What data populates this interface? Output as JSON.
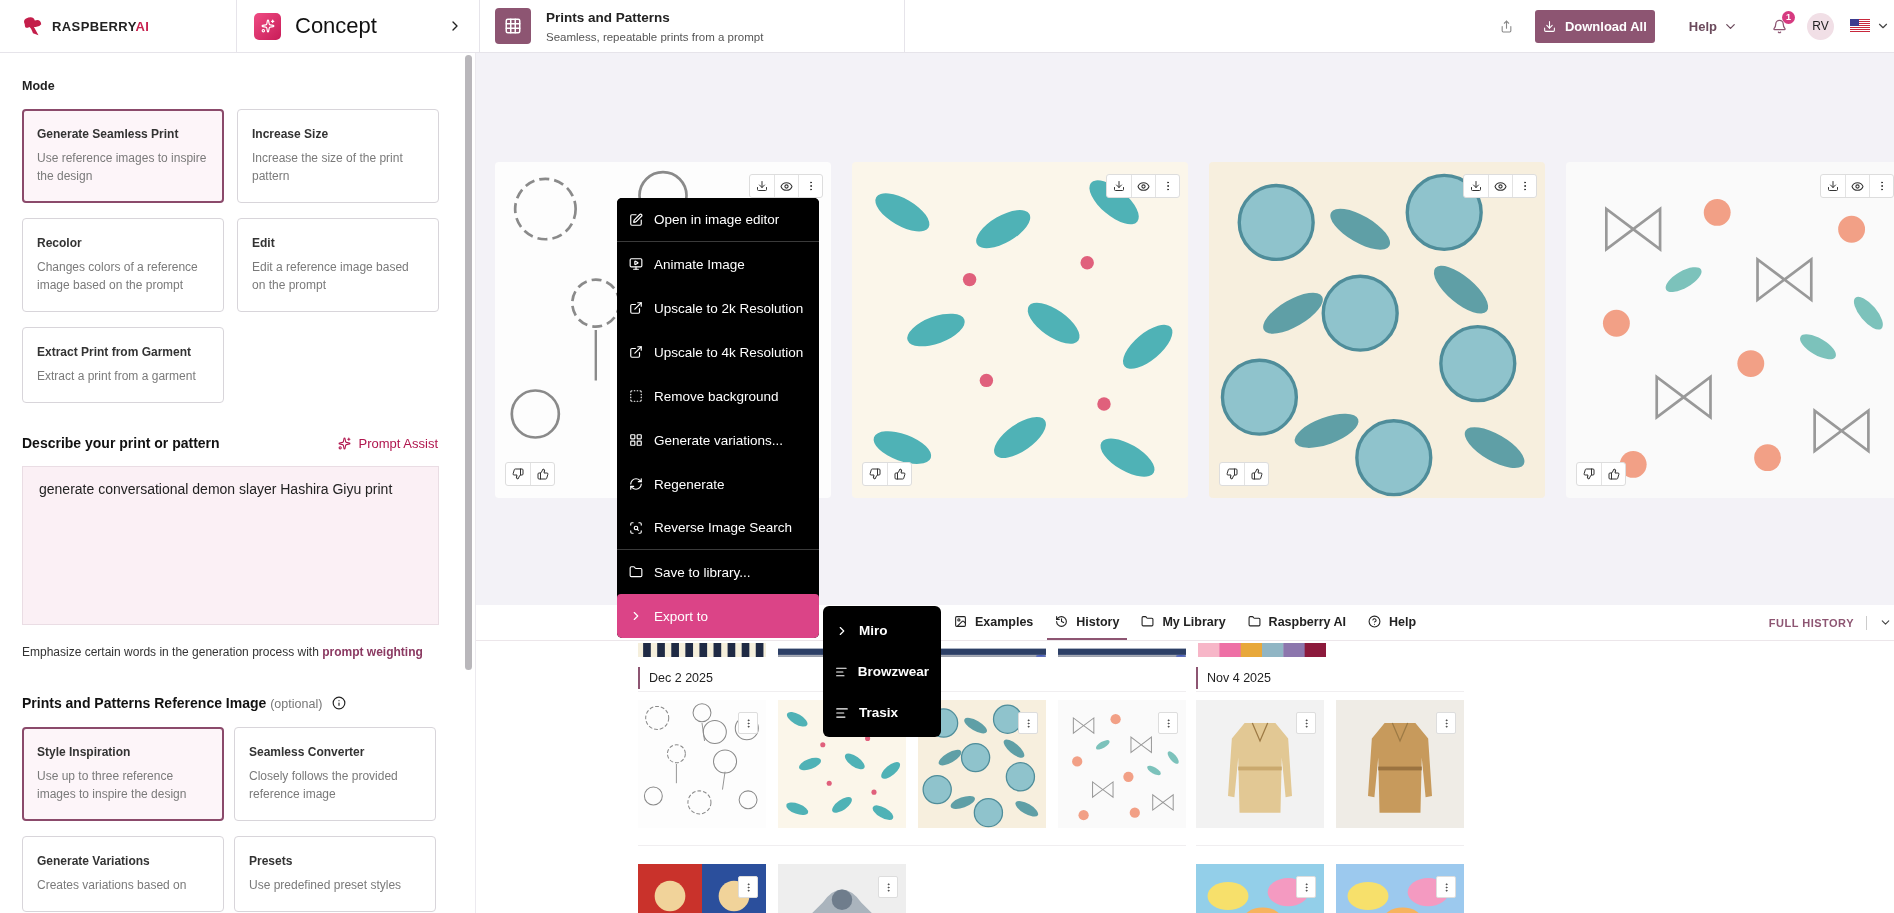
{
  "header": {
    "brand": "RASPBERRY",
    "brand_accent": "AI",
    "section": "Concept",
    "tool_title": "Prints and Patterns",
    "tool_subtitle": "Seamless, repeatable prints from a prompt",
    "download_label": "Download All",
    "help_label": "Help",
    "notification_count": "1",
    "avatar_initials": "RV"
  },
  "sidebar": {
    "mode_label": "Mode",
    "modes": [
      {
        "title": "Generate Seamless Print",
        "description": "Use reference images to inspire the design",
        "selected": true
      },
      {
        "title": "Increase Size",
        "description": "Increase the size of the print pattern",
        "selected": false
      },
      {
        "title": "Recolor",
        "description": "Changes colors of a reference image based on the prompt",
        "selected": false
      },
      {
        "title": "Edit",
        "description": "Edit a reference image based on the prompt",
        "selected": false
      },
      {
        "title": "Extract Print from Garment",
        "description": "Extract a print from a garment",
        "selected": false
      }
    ],
    "prompt_label": "Describe your print or pattern",
    "prompt_assist": "Prompt Assist",
    "prompt_value": "generate conversational demon slayer Hashira Giyu print",
    "hint_text": "Emphasize certain words in the generation process with",
    "hint_link": "prompt weighting",
    "reference_label": "Prints and Patterns Reference Image",
    "reference_optional": "(optional)",
    "reference_modes": [
      {
        "title": "Style Inspiration",
        "description": "Use up to three reference images to inspire the design",
        "selected": true
      },
      {
        "title": "Seamless Converter",
        "description": "Closely follows the provided reference image",
        "selected": false
      },
      {
        "title": "Generate Variations",
        "description": "Creates variations based on",
        "selected": false
      },
      {
        "title": "Presets",
        "description": "Use predefined preset styles",
        "selected": false
      }
    ]
  },
  "context_menu": {
    "items": [
      {
        "label": "Open in image editor",
        "highlighted": false,
        "separated": true
      },
      {
        "label": "Animate Image",
        "highlighted": false,
        "separated": false
      },
      {
        "label": "Upscale to 2k Resolution",
        "highlighted": false,
        "separated": false
      },
      {
        "label": "Upscale to 4k Resolution",
        "highlighted": false,
        "separated": false
      },
      {
        "label": "Remove background",
        "highlighted": false,
        "separated": false
      },
      {
        "label": "Generate variations...",
        "highlighted": false,
        "separated": false
      },
      {
        "label": "Regenerate",
        "highlighted": false,
        "separated": false
      },
      {
        "label": "Reverse Image Search",
        "highlighted": false,
        "separated": true
      },
      {
        "label": "Save to library...",
        "highlighted": false,
        "separated": false
      },
      {
        "label": "Export to",
        "highlighted": true,
        "separated": false
      }
    ]
  },
  "submenu": {
    "items": [
      {
        "label": "Miro",
        "kind": "submenu"
      },
      {
        "label": "Browzwear",
        "kind": "app"
      },
      {
        "label": "Trasix",
        "kind": "app"
      }
    ]
  },
  "history": {
    "tabs": [
      {
        "label": "Examples",
        "selected": false
      },
      {
        "label": "History",
        "selected": true
      },
      {
        "label": "My Library",
        "selected": false
      },
      {
        "label": "Raspberry AI",
        "selected": false
      },
      {
        "label": "Help",
        "selected": false
      }
    ],
    "full_history": "FULL HISTORY",
    "groups": [
      {
        "date": "Dec 2 2025"
      },
      {
        "date": "Nov 4 2025"
      }
    ]
  }
}
